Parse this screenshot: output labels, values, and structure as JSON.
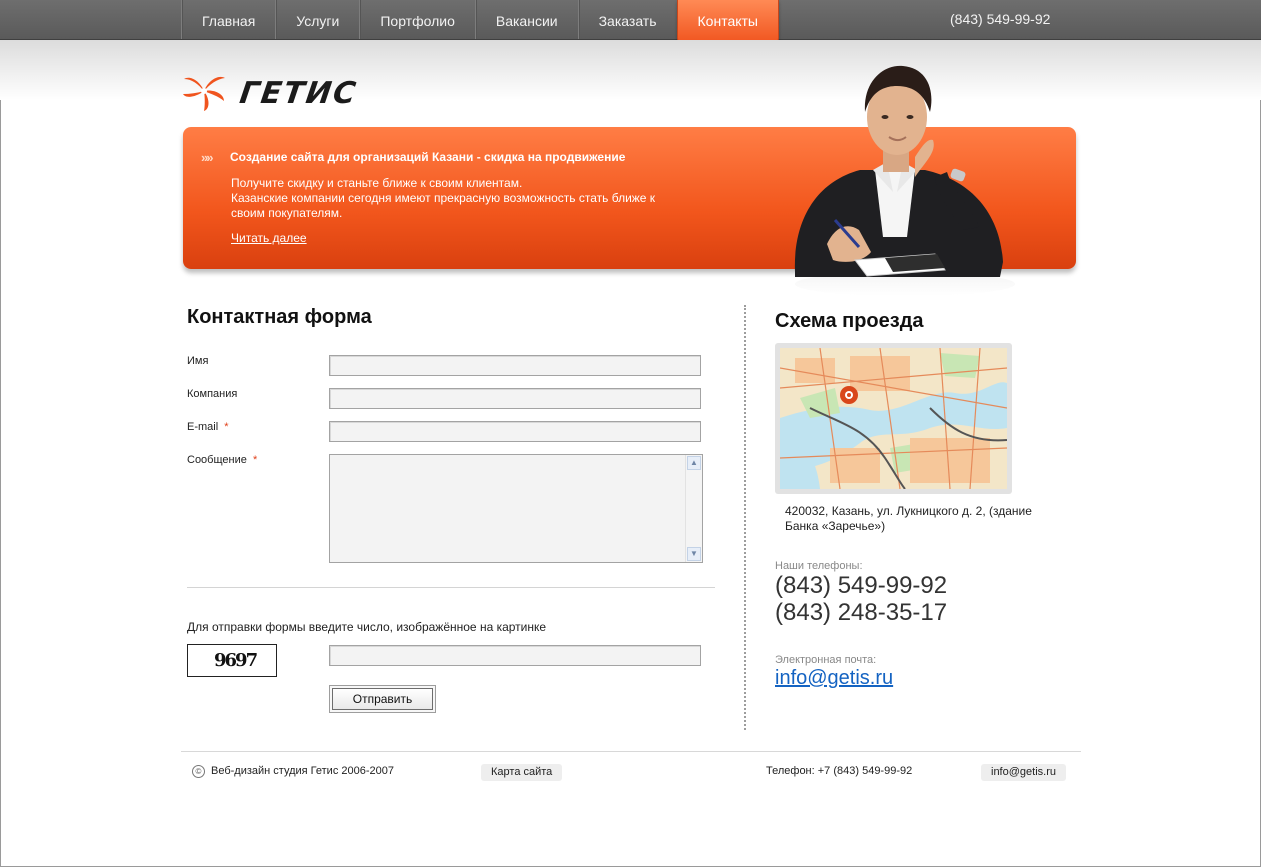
{
  "nav": {
    "items": [
      {
        "label": "Главная"
      },
      {
        "label": "Услуги"
      },
      {
        "label": "Портфолио"
      },
      {
        "label": "Вакансии"
      },
      {
        "label": "Заказать"
      },
      {
        "label": "Контакты",
        "active": true
      }
    ],
    "phone": "(843) 549-99-92"
  },
  "logo": {
    "text": "ГЕТИС",
    "colors": {
      "flower": "#f0541e",
      "text": "#1b1b1b"
    }
  },
  "banner": {
    "arrows": "»»",
    "title": "Создание сайта для организаций Казани - скидка на продвижение",
    "lines": [
      "Получите скидку и станьте ближе к своим клиентам.",
      "Казанские компании сегодня имеют прекрасную возможность стать ближе к своим покупателям."
    ],
    "link": "Читать далее",
    "accent": "#f2561c"
  },
  "form": {
    "title": "Контактная форма",
    "fields": {
      "name": {
        "label": "Имя",
        "value": ""
      },
      "company": {
        "label": "Компания",
        "value": ""
      },
      "email": {
        "label": "E-mail",
        "required": "*",
        "value": ""
      },
      "message": {
        "label": "Сообщение",
        "required": "*",
        "value": ""
      }
    },
    "captcha_prompt": "Для отправки формы введите число, изображённое на картинке",
    "captcha_code": "9697",
    "captcha_value": "",
    "submit_label": "Отправить"
  },
  "contacts": {
    "map_title": "Схема проезда",
    "address": "420032, Казань, ул. Лукницкого д. 2, (здание Банка «Заречье»)",
    "phones_label": "Наши телефоны:",
    "phones": [
      "(843) 549-99-92",
      "(843) 248-35-17"
    ],
    "email_label": "Электронная почта:",
    "email": "info@getis.ru"
  },
  "footer": {
    "copyright_symbol": "©",
    "copyright": "Веб-дизайн студия Гетис 2006-2007",
    "sitemap": "Карта сайта",
    "phone": "Телефон: +7 (843) 549-99-92",
    "email": "info@getis.ru"
  }
}
